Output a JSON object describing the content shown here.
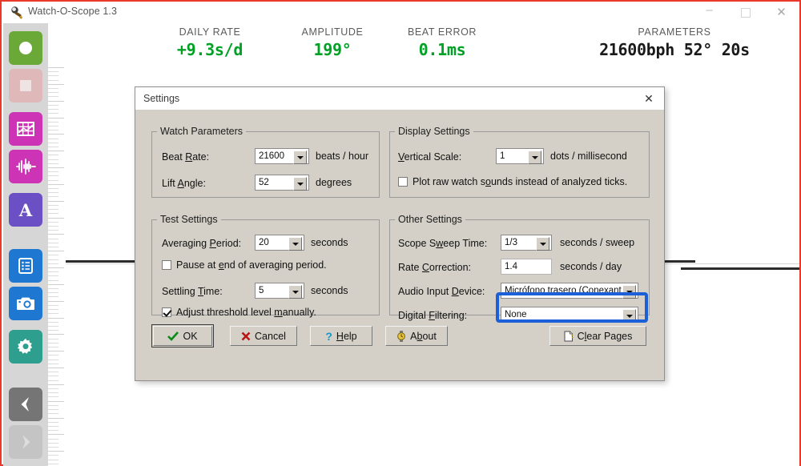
{
  "window": {
    "title": "Watch-O-Scope 1.3",
    "app_icon": "microphone-icon",
    "minimize_label": "–",
    "maximize_label": "",
    "close_label": "✕"
  },
  "readouts": [
    {
      "key": "daily_rate",
      "label": "DAILY RATE",
      "value": "+9.3s/d",
      "color": "#00a226"
    },
    {
      "key": "amplitude",
      "label": "AMPLITUDE",
      "value": "199°",
      "color": "#00a226"
    },
    {
      "key": "beat_error",
      "label": "BEAT ERROR",
      "value": "0.1ms",
      "color": "#00a226"
    },
    {
      "key": "parameters",
      "label": "PARAMETERS",
      "value": "21600bph 52° 20s",
      "color": "#1a1a1a"
    }
  ],
  "sidebar": {
    "items": [
      {
        "name": "record-button",
        "icon": "circle-icon",
        "bg": "#6aa937",
        "fg": "#ffffff",
        "enabled": true
      },
      {
        "name": "stop-button",
        "icon": "square-icon",
        "bg": "#dfb9b9",
        "fg": "#efe4e4",
        "enabled": false
      },
      {
        "name": "graph-view-button",
        "icon": "grid-chart-icon",
        "bg": "#cc33b5",
        "fg": "#ffffff",
        "enabled": true
      },
      {
        "name": "waveform-view-button",
        "icon": "waveform-icon",
        "bg": "#cc33b5",
        "fg": "#ffffff",
        "enabled": true
      },
      {
        "name": "annotate-button",
        "icon": "letter-a-icon",
        "bg": "#6b4fc4",
        "fg": "#ffffff",
        "enabled": true
      },
      {
        "name": "report-button",
        "icon": "list-document-icon",
        "bg": "#1e77d1",
        "fg": "#ffffff",
        "enabled": true
      },
      {
        "name": "snapshot-button",
        "icon": "camera-icon",
        "bg": "#1e77d1",
        "fg": "#ffffff",
        "enabled": true
      },
      {
        "name": "settings-button",
        "icon": "gear-icon",
        "bg": "#2e9e8f",
        "fg": "#ffffff",
        "enabled": true
      },
      {
        "name": "previous-page-button",
        "icon": "chevron-left-icon",
        "bg": "#757575",
        "fg": "#ffffff",
        "enabled": true
      },
      {
        "name": "next-page-button",
        "icon": "chevron-right-icon",
        "bg": "#c4c4c4",
        "fg": "#dddddd",
        "enabled": false
      }
    ]
  },
  "dialog": {
    "title": "Settings",
    "close_label": "✕",
    "watch_parameters": {
      "legend": "Watch Parameters",
      "beat_rate": {
        "label": "Beat Rate:",
        "accel": "R",
        "value": "21600",
        "unit": "beats / hour",
        "type": "combobox"
      },
      "lift_angle": {
        "label": "Lift Angle:",
        "accel": "A",
        "value": "52",
        "unit": "degrees",
        "type": "combobox"
      }
    },
    "display_settings": {
      "legend": "Display Settings",
      "vertical_scale": {
        "label": "Vertical Scale:",
        "accel": "V",
        "value": "1",
        "unit": "dots / millisecond",
        "type": "combobox"
      },
      "plot_raw": {
        "label": "Plot raw watch sounds instead of analyzed ticks.",
        "accel": "o",
        "checked": false
      }
    },
    "test_settings": {
      "legend": "Test Settings",
      "averaging_period": {
        "label": "Averaging Period:",
        "accel": "P",
        "value": "20",
        "unit": "seconds",
        "type": "combobox"
      },
      "pause_at_end": {
        "label": "Pause at end of averaging period.",
        "accel": "e",
        "checked": false
      },
      "settling_time": {
        "label": "Settling Time:",
        "accel": "T",
        "value": "5",
        "unit": "seconds",
        "type": "combobox"
      },
      "adjust_threshold": {
        "label": "Adjust threshold level manually.",
        "accel": "m",
        "checked": true
      }
    },
    "other_settings": {
      "legend": "Other Settings",
      "scope_sweep_time": {
        "label": "Scope Sweep Time:",
        "accel": "w",
        "value": "1/3",
        "unit": "seconds / sweep",
        "type": "combobox"
      },
      "rate_correction": {
        "label": "Rate Correction:",
        "accel": "C",
        "value": "1.4",
        "unit": "seconds / day",
        "type": "textbox"
      },
      "audio_input_device": {
        "label": "Audio Input Device:",
        "accel": "D",
        "value": "Micrófono trasero (Conexant Sr",
        "type": "combobox"
      },
      "digital_filtering": {
        "label": "Digital Filtering:",
        "accel": "F",
        "value": "None",
        "type": "combobox",
        "highlighted": true,
        "highlight_color": "#1b5fd9"
      }
    },
    "buttons": [
      {
        "name": "ok-button",
        "label": "OK",
        "icon": "green-check-icon",
        "default": true
      },
      {
        "name": "cancel-button",
        "label": "Cancel",
        "icon": "red-x-icon",
        "default": false
      },
      {
        "name": "help-button",
        "label": "Help",
        "accel": "H",
        "icon": "question-mark-icon",
        "default": false
      },
      {
        "name": "about-button",
        "label": "About",
        "accel": "b",
        "icon": "watch-icon",
        "default": false
      },
      {
        "name": "clear-pages-button",
        "label": "Clear Pages",
        "accel": "l",
        "icon": "page-icon",
        "default": false
      }
    ]
  },
  "scope": {
    "trace_color": "#2b2b2b",
    "ruler_ticks": 96
  }
}
